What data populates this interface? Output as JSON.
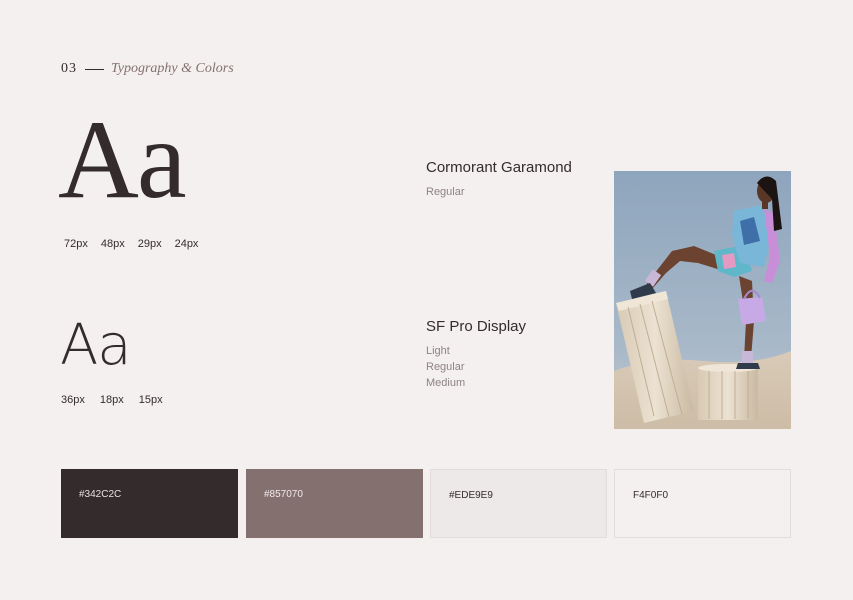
{
  "header": {
    "number": "03",
    "title": "Typography & Colors"
  },
  "typography": {
    "serif": {
      "sample": "Aa",
      "sizes": [
        "72px",
        "48px",
        "29px",
        "24px"
      ],
      "font_name": "Cormorant Garamond",
      "weights": [
        "Regular"
      ]
    },
    "sans": {
      "sample": "Aa",
      "sizes": [
        "36px",
        "18px",
        "15px"
      ],
      "font_name": "SF Pro Display",
      "weights": [
        "Light",
        "Regular",
        "Medium"
      ]
    }
  },
  "palette": [
    {
      "label": "#342C2C",
      "color": "#342C2C"
    },
    {
      "label": "#857070",
      "color": "#857070"
    },
    {
      "label": "#EDE9E9",
      "color": "#EDE9E9"
    },
    {
      "label": "F4F0F0",
      "color": "#F4F0F0"
    }
  ],
  "photo": {
    "icon": "fashion-model-photo"
  }
}
